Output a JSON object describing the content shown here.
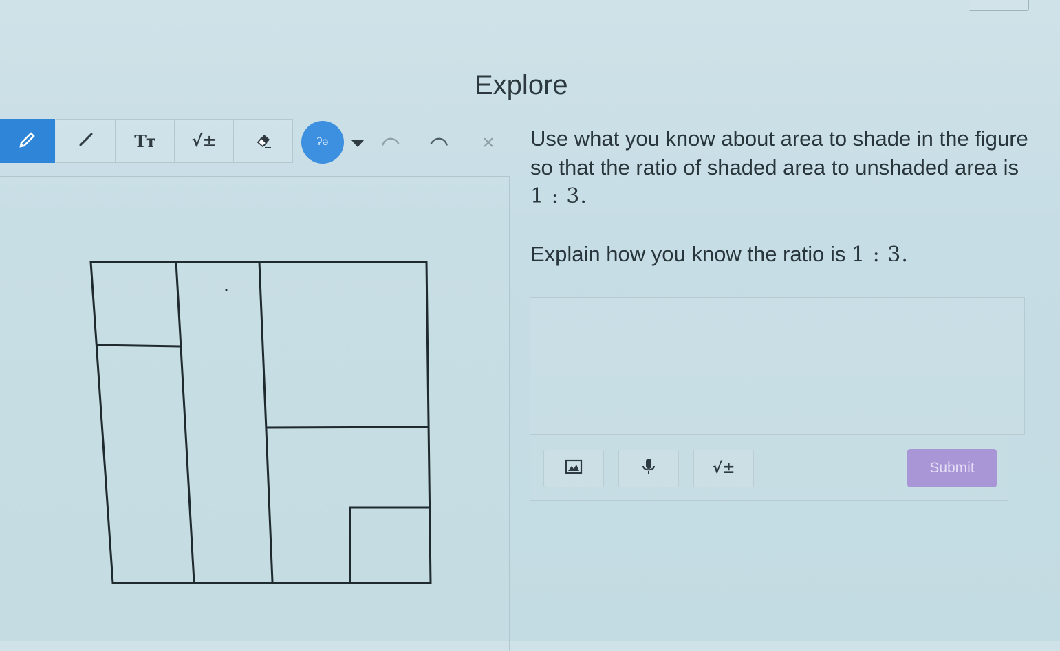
{
  "page": {
    "title": "Explore"
  },
  "toolbar": {
    "tools": [
      {
        "name": "pencil-icon",
        "active": true
      },
      {
        "name": "line-icon",
        "active": false
      },
      {
        "name": "text-icon",
        "label": "Tт",
        "active": false
      },
      {
        "name": "math-icon",
        "label": "√±",
        "active": false
      },
      {
        "name": "eraser-icon",
        "active": false
      }
    ],
    "color": {
      "value": "#3d8fe0",
      "glyph": "ʔə"
    },
    "undo_icon": "undo-icon",
    "redo_icon": "redo-icon",
    "clear_label": "×"
  },
  "prompt": {
    "text_1": "Use what you know about area to shade in the figure so that the ratio of shaded area to unshaded area is",
    "ratio_1": "1 : 3.",
    "text_2": "Explain how you know the ratio is",
    "ratio_2": "1 : 3."
  },
  "answer": {
    "value": "",
    "buttons": {
      "image": "image-icon",
      "mic": "microphone-icon",
      "math_label": "√±",
      "submit_label": "Submit"
    }
  },
  "colors": {
    "accent": "#2f86d9",
    "submit": "#a996d6"
  }
}
